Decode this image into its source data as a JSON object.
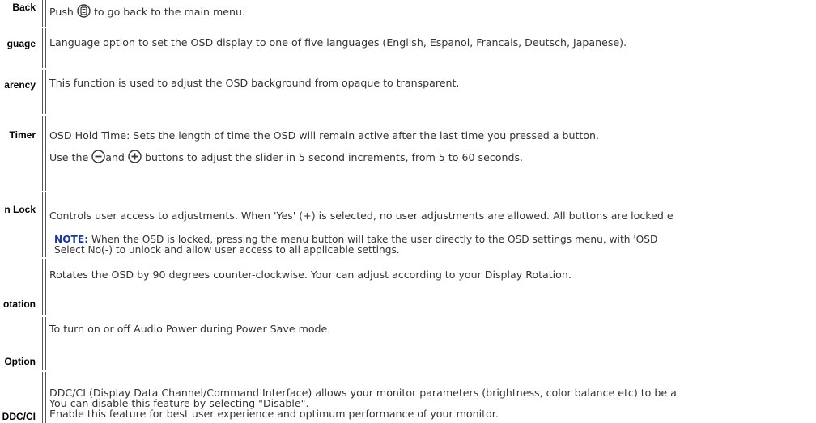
{
  "rows": {
    "back": {
      "label": "Back",
      "pre": "Push",
      "post": "to go back to the main menu.",
      "icon": "menu-button-icon"
    },
    "language": {
      "label": "guage",
      "text": "Language option to set the OSD display to one of five languages (English, Espanol, Francais, Deutsch, Japanese)."
    },
    "transparency": {
      "label": "arency",
      "text": "This function is used to adjust the OSD background from opaque to transparent."
    },
    "timer": {
      "label": "Timer",
      "line1": "OSD Hold Time: Sets the length of time the OSD will remain active after the last time you pressed a button.",
      "line2_pre": "Use the",
      "line2_mid": "and",
      "line2_post": "buttons to adjust the slider in 5 second increments, from 5 to 60 seconds.",
      "minus_icon": "minus-button-icon",
      "plus_icon": "plus-button-icon"
    },
    "lock": {
      "label": "n Lock",
      "text": "Controls user access to adjustments. When 'Yes' (+) is selected, no user adjustments are allowed. All buttons are locked e",
      "note_label": "NOTE:",
      "note_text": " When the OSD is locked, pressing the menu button will take the user directly to the OSD settings menu, with 'OSD",
      "note_line2": "Select No(-) to unlock and allow user access to all applicable settings."
    },
    "rotation": {
      "label": "otation",
      "text": "Rotates the OSD by 90 degrees counter-clockwise. Your can adjust according to your Display Rotation."
    },
    "audio": {
      "label": "Option",
      "text": "To turn on or off Audio Power during Power Save mode."
    },
    "ddcci": {
      "label": "DDC/CI",
      "line1": "DDC/CI (Display Data Channel/Command Interface) allows your monitor parameters (brightness, color balance etc) to be a",
      "line2": "You can disable this feature by selecting \"Disable\".",
      "line3": "Enable this feature for best user experience and optimum performance of your monitor."
    }
  },
  "colors": {
    "text": "#333333",
    "note": "#1a3a8c",
    "separator": "#555555"
  }
}
